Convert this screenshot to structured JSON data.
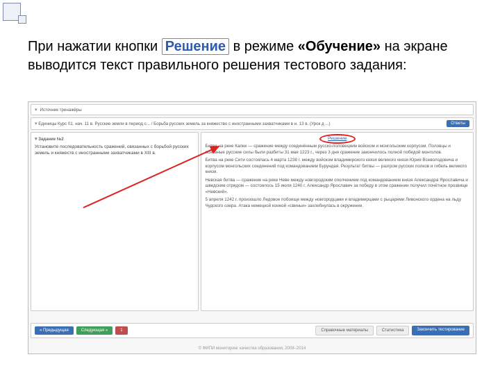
{
  "slide": {
    "text_prefix": "При нажатии кнопки ",
    "button_word": "Решение",
    "text_middle": " в режиме ",
    "mode_bold": "«Обучение»",
    "text_suffix_line": " на экране выводится текст правильного решения тестового задания:"
  },
  "app": {
    "breadcrumb1": "Источник тренажёры",
    "breadcrumb2": "Единицы Курс 01. нач. 11 в. Русские земли в период с... / Борьба русских земель за княжество с иностранными захватчиками в н. 13 в. (Урок д ...)",
    "answers_btn": "Ответы",
    "task_title": "Задание №2",
    "task_body": "Установите последовательность сражений, связанных с борьбой русских земель и княжеств с иностранными захватчиками в XIII в.",
    "solution_label": "Решение",
    "solution_paragraphs": [
      "Битва на реке Калке — сражение между соединённым русско-половецким войском и монгольским корпусом. Половцы и основные русские силы были разбиты 31 мая 1223 г., через 3 дня сражение закончилось полной победой монголов.",
      "Битва на реке Сити состоялась 4 марта 1238 г. между войском владимирского князя великого князя Юрия Всеволодовича и корпусом монгольских соединений под командованием Бурундая. Результат битвы — разгром русских полков и гибель великого князя.",
      "Невская битва — сражение на реке Неве между новгородским ополчением под командованием князя Александра Ярославича и шведским отрядом — состоялось 15 июля 1240 г. Александр Ярославич за победу в этом сражении получил почётное прозвище «Невский».",
      "5 апреля 1242 г. произошло Ледовое побоище между новгородцами и владимирцами с рыцарями Ливонского ордена на льду Чудского озера. Атака немецкой конной «свиньи» захлебнулась в окружении."
    ],
    "footer": {
      "prev": "« Предыдущая",
      "next": "Следующая »",
      "pager": "1",
      "ref_materials": "Справочные материалы",
      "status": "Статистика",
      "finish": "Закончить тестирование"
    },
    "copyright": "© ФИПИ мониторинг качества образования, 2008–2014"
  }
}
